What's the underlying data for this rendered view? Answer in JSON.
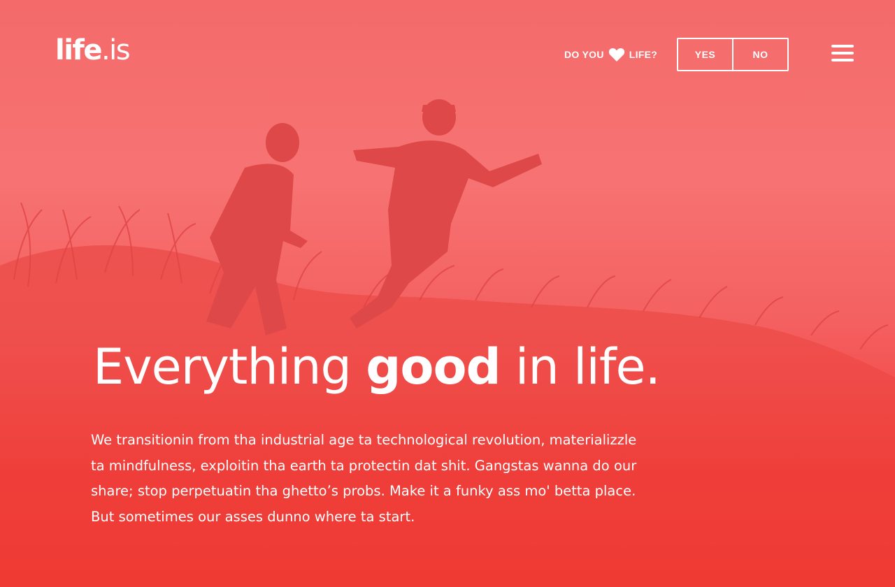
{
  "brand": {
    "name": "life",
    "tld": ".is"
  },
  "header": {
    "prompt_before": "DO YOU",
    "prompt_icon": "heart-icon",
    "prompt_after": "LIFE?",
    "vote": {
      "yes_label": "YES",
      "no_label": "NO"
    },
    "menu_icon": "hamburger-menu-icon"
  },
  "hero": {
    "headline_pre": "Everything ",
    "headline_bold": "good",
    "headline_post": " in life.",
    "body": "We transitionin from tha industrial age ta technological revolution, materializzle ta mindfulness, exploitin tha earth ta protectin dat shit. Gangstas wanna do our share; stop perpetuatin tha ghetto’s probs. Make it a funky ass mo' betta place. But sometimes our asses dunno where ta start."
  },
  "colors": {
    "overlay_top": "#f46a6a",
    "overlay_bottom": "#ef3a33",
    "silhouette": "#e43c3c",
    "text": "#ffffff"
  }
}
